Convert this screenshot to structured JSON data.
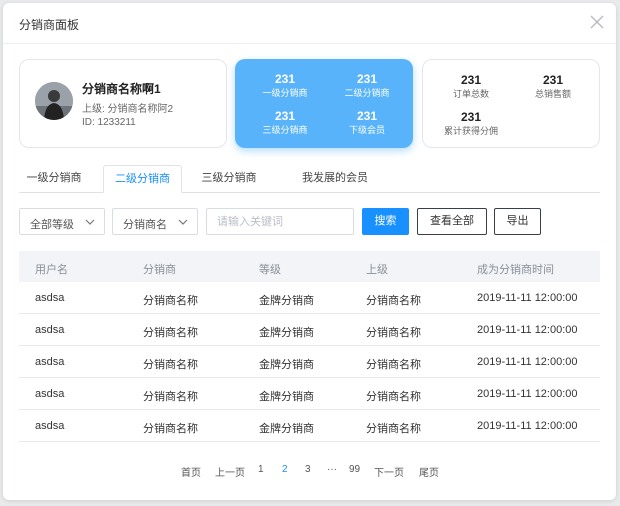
{
  "dialog": {
    "title": "分销商面板"
  },
  "profile": {
    "name": "分销商名称啊1",
    "superior": "上级: 分销商名称阿2",
    "id": "ID: 1233211"
  },
  "levels_card": {
    "items": [
      {
        "value": "231",
        "label": "一级分销商"
      },
      {
        "value": "231",
        "label": "二级分销商"
      },
      {
        "value": "231",
        "label": "三级分销商"
      },
      {
        "value": "231",
        "label": "下级会员"
      }
    ]
  },
  "totals_card": {
    "items": [
      {
        "value": "231",
        "label": "订单总数"
      },
      {
        "value": "231",
        "label": "总销售额"
      },
      {
        "value": "231",
        "label": "累计获得分佣"
      }
    ]
  },
  "tabs": [
    {
      "label": "一级分销商",
      "active": false
    },
    {
      "label": "二级分销商",
      "active": true
    },
    {
      "label": "三级分销商",
      "active": false
    },
    {
      "label": "我发展的会员",
      "active": false
    }
  ],
  "filters": {
    "level_select": "全部等级",
    "field_select": "分销商名",
    "search_placeholder": "请输入关键词",
    "search_button": "搜索",
    "view_all_button": "查看全部",
    "export_button": "导出"
  },
  "table": {
    "columns": [
      "用户名",
      "分销商",
      "等级",
      "上级",
      "成为分销商时间"
    ],
    "rows": [
      [
        "asdsa",
        "分销商名称",
        "金牌分销商",
        "分销商名称",
        "2019-11-11 12:00:00"
      ],
      [
        "asdsa",
        "分销商名称",
        "金牌分销商",
        "分销商名称",
        "2019-11-11 12:00:00"
      ],
      [
        "asdsa",
        "分销商名称",
        "金牌分销商",
        "分销商名称",
        "2019-11-11 12:00:00"
      ],
      [
        "asdsa",
        "分销商名称",
        "金牌分销商",
        "分销商名称",
        "2019-11-11 12:00:00"
      ],
      [
        "asdsa",
        "分销商名称",
        "金牌分销商",
        "分销商名称",
        "2019-11-11 12:00:00"
      ]
    ]
  },
  "pagination": {
    "first": "首页",
    "prev": "上一页",
    "pages": [
      "1",
      "2",
      "3"
    ],
    "current": "2",
    "ellipsis": "···",
    "last_page": "99",
    "next": "下一页",
    "last": "尾页"
  },
  "colors": {
    "accent": "#1890ff",
    "card_blue": "#58b3fb"
  },
  "icons": [
    "close-icon",
    "chevron-down-icon",
    "avatar"
  ]
}
